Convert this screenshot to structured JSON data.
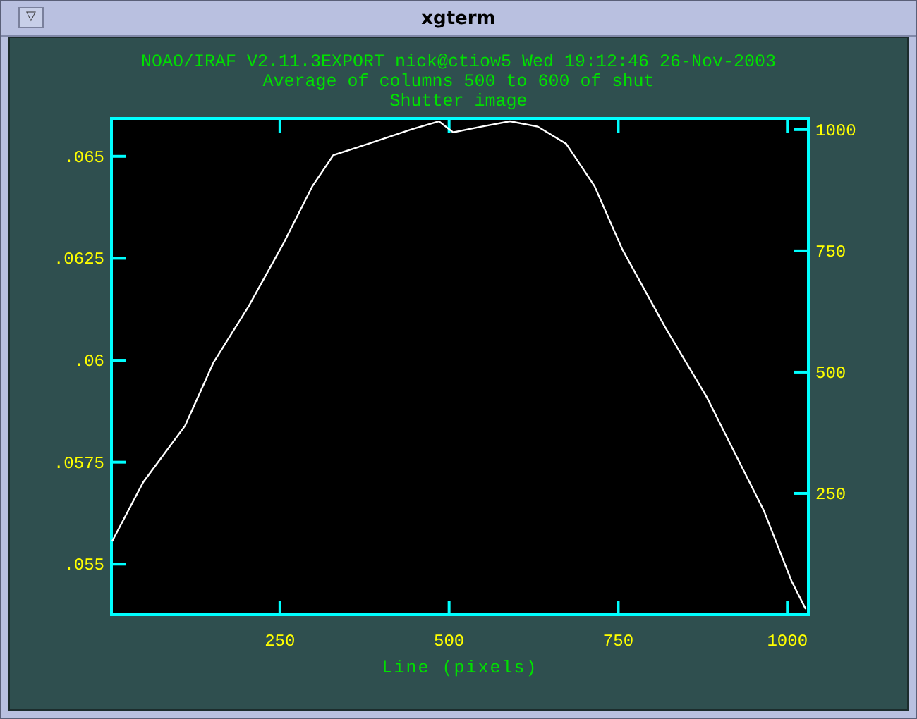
{
  "window": {
    "title": "xgterm",
    "menu_glyph": "▽"
  },
  "header_lines": [
    "NOAO/IRAF V2.11.3EXPORT nick@ctiow5 Wed 19:12:46 26-Nov-2003",
    "Average of columns 500 to 600 of shut",
    "Shutter image"
  ],
  "chart_data": {
    "type": "line",
    "xlabel": "Line (pixels)",
    "xlim": [
      1,
      1031
    ],
    "ylim": [
      0.05376,
      0.06593
    ],
    "xticks": [
      250,
      500,
      750,
      1000
    ],
    "yticks": [
      {
        "value": 0.055,
        "label": ".055"
      },
      {
        "value": 0.0575,
        "label": ".0575"
      },
      {
        "value": 0.06,
        "label": ".06"
      },
      {
        "value": 0.0625,
        "label": ".0625"
      },
      {
        "value": 0.065,
        "label": ".065"
      }
    ],
    "y2lim": [
      0,
      1023
    ],
    "y2ticks": [
      250,
      500,
      750,
      1000
    ],
    "x": [
      2,
      48,
      110,
      152,
      204,
      256,
      298,
      329,
      381,
      444,
      485,
      506,
      548,
      590,
      631,
      673,
      715,
      756,
      819,
      881,
      923,
      965,
      1006,
      1027
    ],
    "series": [
      {
        "color": "#ffffff",
        "values": [
          0.05556,
          0.05701,
          0.0584,
          0.05995,
          0.06133,
          0.06289,
          0.06427,
          0.06503,
          0.06531,
          0.06566,
          0.06586,
          0.06559,
          0.06573,
          0.06586,
          0.06573,
          0.06531,
          0.06427,
          0.06272,
          0.06082,
          0.05909,
          0.0577,
          0.05632,
          0.05459,
          0.0539
        ]
      }
    ]
  }
}
